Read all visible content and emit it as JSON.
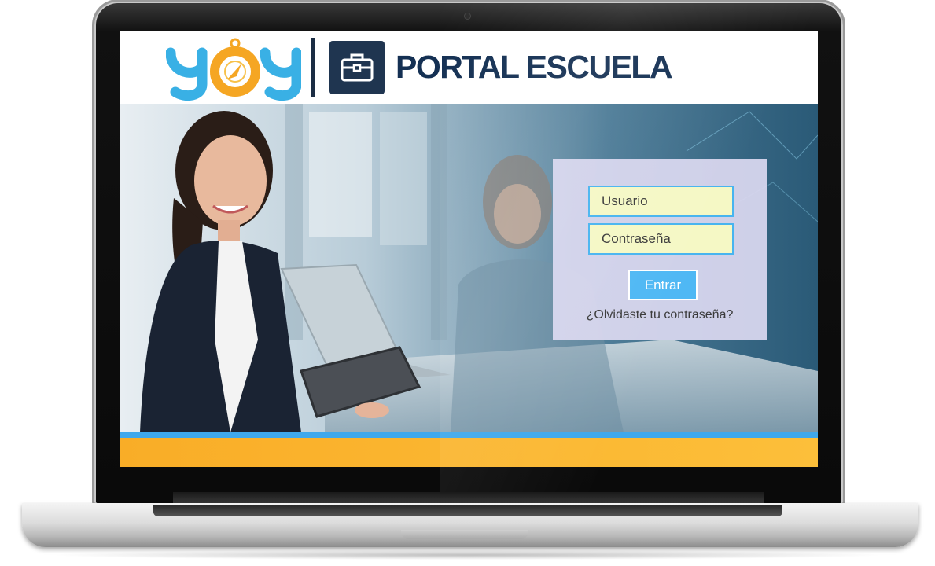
{
  "header": {
    "logo_text": "yoy",
    "portal_title": "PORTAL ESCUELA",
    "briefcase_icon": "briefcase-icon"
  },
  "login": {
    "username_placeholder": "Usuario",
    "password_placeholder": "Contraseña",
    "submit_label": "Entrar",
    "forgot_password_label": "¿Olvidaste tu contraseña?"
  },
  "colors": {
    "brand_navy": "#143053",
    "logo_blue": "#39b0e5",
    "logo_orange": "#f5a623",
    "field_border": "#47b4ef",
    "field_fill": "#f5f8c5",
    "button": "#4fb8f4",
    "footer_blue": "#3fa8ec",
    "footer_orange": "#f9ad27"
  }
}
